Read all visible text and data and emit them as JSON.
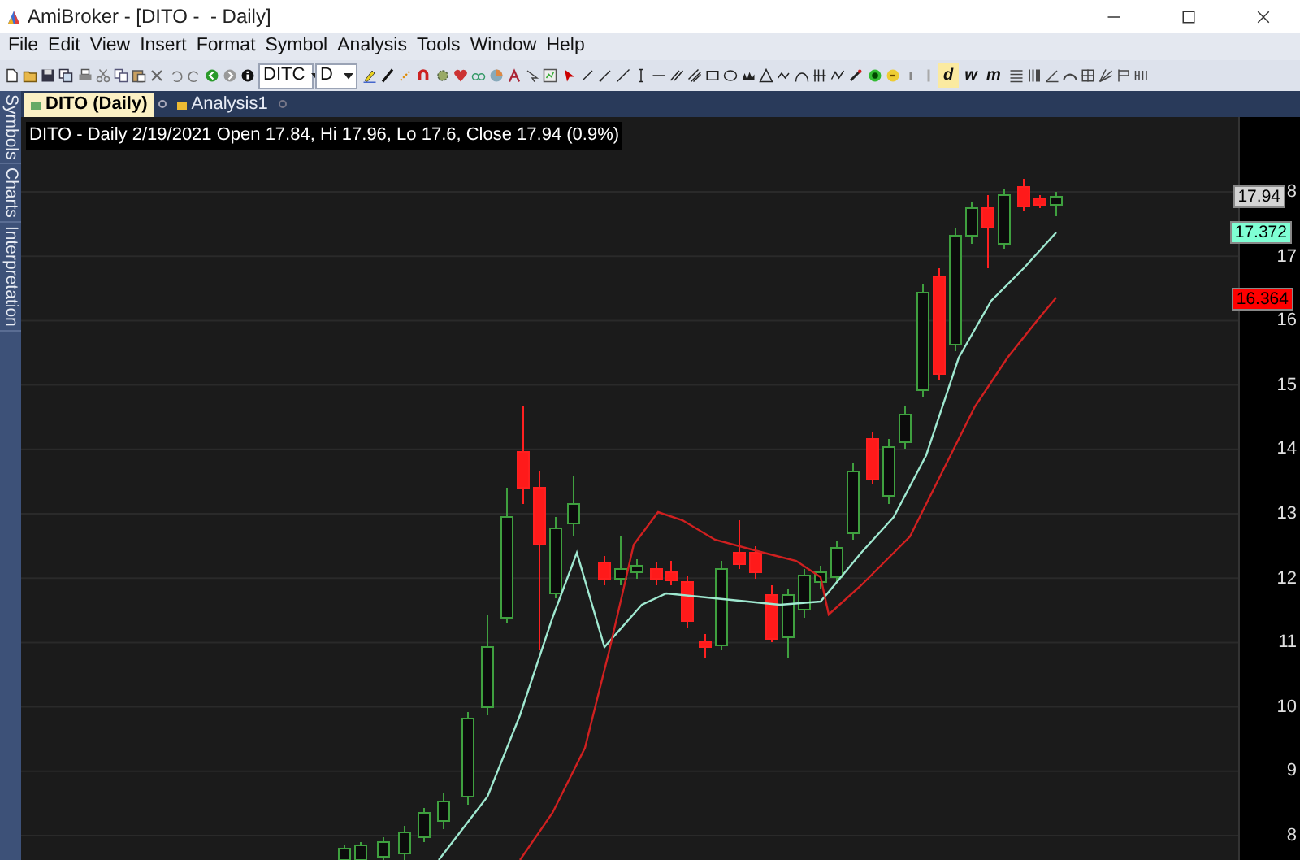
{
  "window": {
    "title": "AmiBroker - [DITO -  - Daily]"
  },
  "menu": [
    "File",
    "Edit",
    "View",
    "Insert",
    "Format",
    "Symbol",
    "Analysis",
    "Tools",
    "Window",
    "Help"
  ],
  "toolbar": {
    "symbol": "DITC",
    "interval": "D",
    "interval_buttons": [
      {
        "label": "d",
        "selected": true
      },
      {
        "label": "w",
        "selected": false
      },
      {
        "label": "m",
        "selected": false
      }
    ]
  },
  "side_tabs": [
    "Symbols",
    "Charts",
    "Interpretation"
  ],
  "doc_tabs": [
    {
      "label": "DITO (Daily)",
      "selected": true
    },
    {
      "label": "Analysis1",
      "selected": false
    }
  ],
  "chart": {
    "caption": "DITO - Daily 2/19/2021 Open 17.84, Hi 17.96, Lo 17.6, Close 17.94 (0.9%)",
    "y_axis_labels": [
      "8",
      "17",
      "16",
      "15",
      "14",
      "13",
      "12",
      "11",
      "10",
      "9",
      "8"
    ],
    "price_tags": [
      {
        "text": "17.94",
        "color": "#d4d4d4"
      },
      {
        "text": "17.372",
        "color": "#7fffd4"
      },
      {
        "text": "16.364",
        "color": "#ff0000"
      }
    ]
  }
}
